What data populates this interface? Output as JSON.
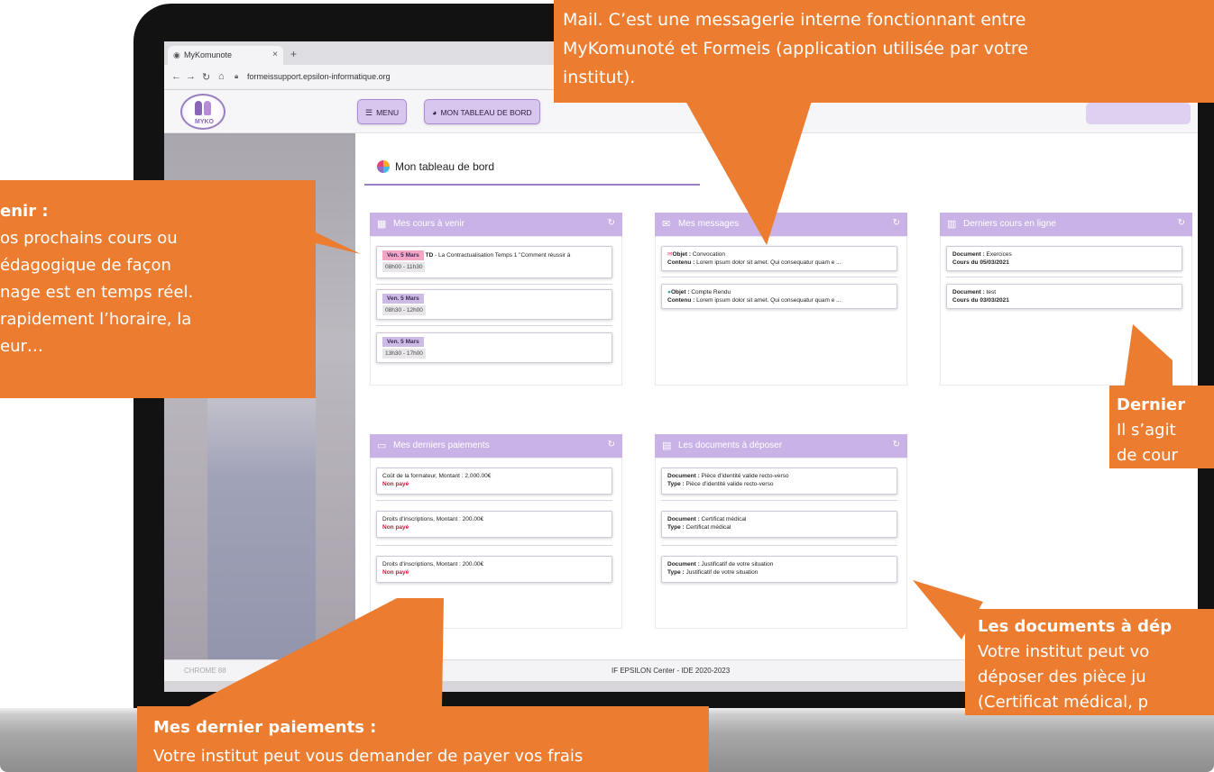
{
  "browser": {
    "tab_title": "MyKomunote",
    "new_tab_symbol": "+",
    "tab_close_symbol": "×",
    "url": "formeissupport.epsilon-informatique.org",
    "nav_icons": [
      "back-arrow-icon",
      "forward-arrow-icon",
      "reload-icon",
      "home-icon"
    ]
  },
  "app": {
    "logo_text": "MYKO",
    "menu_label": "MENU",
    "dashboard_button_label": "MON TABLEAU DE BORD",
    "page_title": "Mon tableau de bord",
    "accent": "#c9b2e6",
    "primary": "#9b7fc4"
  },
  "cards": {
    "courses": {
      "title": "Mes cours à venir",
      "items": [
        {
          "date": "Ven. 5 Mars",
          "time": "08h00 - 11h30",
          "label": "TD",
          "desc": " - La Contractualisation Temps 1 \"Comment réussir à"
        },
        {
          "date": "Ven. 5 Mars",
          "time": "08h30 - 12h00"
        },
        {
          "date": "Ven. 5 Mars",
          "time": "13h30 - 17h00"
        }
      ]
    },
    "messages": {
      "title": "Mes messages",
      "items": [
        {
          "object_label": "Objet :",
          "object": " Convocation",
          "content_label": "Contenu :",
          "content": " Lorem ipsum dolor sit amet. Qui consequatur quam e ..."
        },
        {
          "object_label": "Objet :",
          "object": " Compte Rendu",
          "content_label": "Contenu :",
          "content": " Lorem ipsum dolor sit amet. Qui consequatur quam e ..."
        }
      ]
    },
    "online": {
      "title": "Derniers cours en ligne",
      "items": [
        {
          "doc_label": "Document :",
          "doc": " Exercices",
          "course": "Cours du 05/03/2021"
        },
        {
          "doc_label": "Document :",
          "doc": " test",
          "course": "Cours du 03/03/2021"
        }
      ]
    },
    "payments": {
      "title": "Mes derniers paiements",
      "items": [
        {
          "text": "Coût de la formateur, Montant : 2,000.00€",
          "status": "Non payé"
        },
        {
          "text": "Droits d'inscriptions, Montant : 200.00€",
          "status": "Non payé"
        },
        {
          "text": "Droits d'inscriptions, Montant : 200.00€",
          "status": "Non payé"
        }
      ]
    },
    "documents": {
      "title": "Les documents à déposer",
      "items": [
        {
          "doc_label": "Document :",
          "doc": " Pièce d'identité valide recto-verso",
          "type_label": "Type :",
          "type": " Pièce d'identité valide recto-verso"
        },
        {
          "doc_label": "Document :",
          "doc": " Certificat médical",
          "type_label": "Type :",
          "type": " Certificat médical"
        },
        {
          "doc_label": "Document :",
          "doc": " Justificatif de votre situation",
          "type_label": "Type :",
          "type": " Justificatif de votre situation"
        }
      ]
    }
  },
  "status": {
    "chrome": "CHROME 88",
    "footer": "IF EPSILON Center - IDE 2020-2023"
  },
  "callouts": {
    "mail": {
      "lines": [
        "Mail. C’est une messagerie interne fonctionnant entre",
        "MyKomunoté et Formeis (application utilisée par votre",
        "institut)."
      ]
    },
    "courses": {
      "title": "enir :",
      "lines": [
        "os prochains cours ou",
        "édagogique de façon",
        "nage est en temps réel.",
        " rapidement l’horaire, la",
        "eur…"
      ]
    },
    "online": {
      "title": "Dernier",
      "lines": [
        "Il s’agit",
        "de cour"
      ]
    },
    "documents": {
      "title": "Les documents à dép",
      "lines": [
        "Votre institut peut vo",
        "déposer des pièce ju",
        "(Certificat médical, p"
      ]
    },
    "payments": {
      "title": "Mes dernier paiements :",
      "lines": [
        "Votre institut peut vous demander de payer vos frais"
      ]
    },
    "color": "#ec7c30"
  }
}
